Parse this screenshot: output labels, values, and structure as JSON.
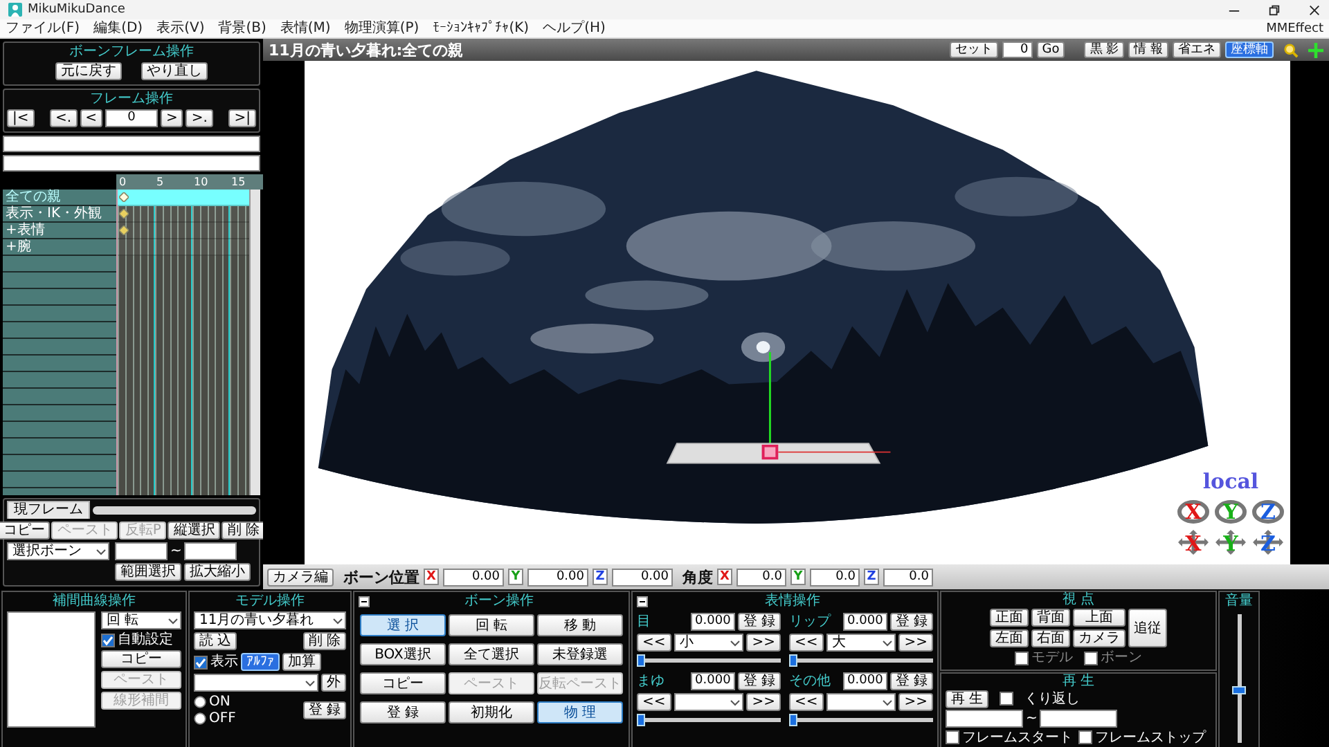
{
  "window": {
    "title": "MikuMikuDance"
  },
  "menu": [
    "ファイル(F)",
    "編集(D)",
    "表示(V)",
    "背景(B)",
    "表情(M)",
    "物理演算(P)",
    "ﾓｰｼｮﾝｷｬﾌﾟﾁｬ(K)",
    "ヘルプ(H)"
  ],
  "menu_right": "MMEffect",
  "bone_frame_panel": {
    "title": "ボーンフレーム操作",
    "undo": "元に戻す",
    "redo": "やり直し",
    "frame_title": "フレーム操作",
    "nav_left": [
      "|<",
      "<.",
      "<"
    ],
    "frame": "0",
    "nav_right": [
      ">",
      ">.",
      ">|"
    ]
  },
  "timeline": {
    "ruler": [
      "0",
      "5",
      "10",
      "15"
    ],
    "rows": [
      {
        "label": "全ての親",
        "selected": true,
        "keyframe": true
      },
      {
        "label": "表示・IK・外観",
        "selected": false,
        "keyframe": true
      },
      {
        "label": "+表情",
        "selected": false,
        "keyframe": true
      },
      {
        "label": "+腕",
        "selected": false,
        "keyframe": false
      }
    ]
  },
  "current_frame_tab": "現フレーム",
  "frame_buttons": [
    {
      "label": "コピー",
      "disabled": false
    },
    {
      "label": "ペースト",
      "disabled": true
    },
    {
      "label": "反転P",
      "disabled": true
    },
    {
      "label": "縦選択",
      "disabled": false
    },
    {
      "label": "削 除",
      "disabled": false
    }
  ],
  "bone_select": "選択ボーン",
  "range_sep": "~",
  "range_buttons": [
    "範囲選択",
    "拡大縮小"
  ],
  "viewport": {
    "title": "11月の青い夕暮れ:全ての親",
    "set_label": "セット",
    "set_value": "0",
    "go": "Go",
    "toggles": [
      {
        "label": "黒 影",
        "selected": false
      },
      {
        "label": "情 報",
        "selected": false
      },
      {
        "label": "省エネ",
        "selected": false
      },
      {
        "label": "座標軸",
        "selected": true
      }
    ],
    "mode_label": "local",
    "rotate_handles": [
      {
        "label": "X",
        "color": "#e01818"
      },
      {
        "label": "Y",
        "color": "#18b018"
      },
      {
        "label": "Z",
        "color": "#1a5ee0"
      }
    ],
    "move_handles": [
      {
        "label": "X",
        "color": "#e01818"
      },
      {
        "label": "Y",
        "color": "#18b018"
      },
      {
        "label": "Z",
        "color": "#1a5ee0"
      }
    ]
  },
  "bone_bar": {
    "camera_button": "カメラ編",
    "position_label": "ボーン位置",
    "position": [
      {
        "axis": "X",
        "value": "0.00",
        "color": "#e01818"
      },
      {
        "axis": "Y",
        "value": "0.00",
        "color": "#18a018"
      },
      {
        "axis": "Z",
        "value": "0.00",
        "color": "#2040e0"
      }
    ],
    "angle_label": "角度",
    "angle": [
      {
        "axis": "X",
        "value": "0.0",
        "color": "#e01818"
      },
      {
        "axis": "Y",
        "value": "0.0",
        "color": "#18a018"
      },
      {
        "axis": "Z",
        "value": "0.0",
        "color": "#2040e0"
      }
    ]
  },
  "interpolation": {
    "title": "補間曲線操作",
    "target": "回 転",
    "auto": {
      "label": "自動設定",
      "checked": true
    },
    "buttons": [
      {
        "label": "コピー",
        "disabled": false
      },
      {
        "label": "ペースト",
        "disabled": true
      },
      {
        "label": "線形補間",
        "disabled": true
      }
    ]
  },
  "model": {
    "title": "モデル操作",
    "model": "11月の青い夕暮れ",
    "buttons": [
      "読 込",
      "削 除"
    ],
    "show": {
      "label": "表示",
      "checked": true
    },
    "blend": [
      {
        "label": "ｱﾙﾌｧ",
        "selected": true
      },
      {
        "label": "加算",
        "selected": false
      }
    ],
    "outer_button": "外",
    "radios": [
      {
        "label": "ON",
        "selected": false
      },
      {
        "label": "OFF",
        "selected": false
      }
    ],
    "register": "登 録"
  },
  "bone_ops": {
    "title": "ボーン操作",
    "buttons": [
      {
        "label": "選 択",
        "selected": true,
        "disabled": false
      },
      {
        "label": "回 転",
        "selected": false,
        "disabled": false
      },
      {
        "label": "移 動",
        "selected": false,
        "disabled": false
      },
      {
        "label": "BOX選択",
        "selected": false,
        "disabled": false
      },
      {
        "label": "全て選択",
        "selected": false,
        "disabled": false
      },
      {
        "label": "未登録選",
        "selected": false,
        "disabled": false
      },
      {
        "label": "コピー",
        "selected": false,
        "disabled": false
      },
      {
        "label": "ペースト",
        "selected": false,
        "disabled": true
      },
      {
        "label": "反転ペースト",
        "selected": false,
        "disabled": true
      },
      {
        "label": "登 録",
        "selected": false,
        "disabled": false
      },
      {
        "label": "初期化",
        "selected": false,
        "disabled": false
      },
      {
        "label": "物 理",
        "selected": true,
        "disabled": false
      }
    ]
  },
  "morph": {
    "title": "表情操作",
    "groups": [
      {
        "label": "目",
        "value": "0.000",
        "register": "登 録",
        "prev": "<<",
        "selection": "小",
        "next": ">>",
        "level": 0
      },
      {
        "label": "リップ",
        "value": "0.000",
        "register": "登 録",
        "prev": "<<",
        "selection": "大",
        "next": ">>",
        "level": 0
      },
      {
        "label": "まゆ",
        "value": "0.000",
        "register": "登 録",
        "prev": "<<",
        "next": ">>",
        "level": 0
      },
      {
        "label": "その他",
        "value": "0.000",
        "register": "登 録",
        "prev": "<<",
        "next": ">>",
        "level": 0
      }
    ]
  },
  "view": {
    "title": "視 点",
    "buttons": [
      "正面",
      "背面",
      "上面",
      "左面",
      "右面",
      "カメラ"
    ],
    "follow": "追従",
    "checks": [
      {
        "label": "モデル",
        "checked": false,
        "disabled": true
      },
      {
        "label": "ボーン",
        "checked": false,
        "disabled": true
      }
    ]
  },
  "playback": {
    "title": "再 生",
    "play": "再 生",
    "repeat": {
      "label": "くり返し",
      "checked": false
    },
    "range_sep": "~",
    "checks": [
      {
        "label": "フレームスタート",
        "checked": false
      },
      {
        "label": "フレームストップ",
        "checked": false
      }
    ]
  },
  "volume": {
    "title": "音量",
    "level": 0.4
  }
}
